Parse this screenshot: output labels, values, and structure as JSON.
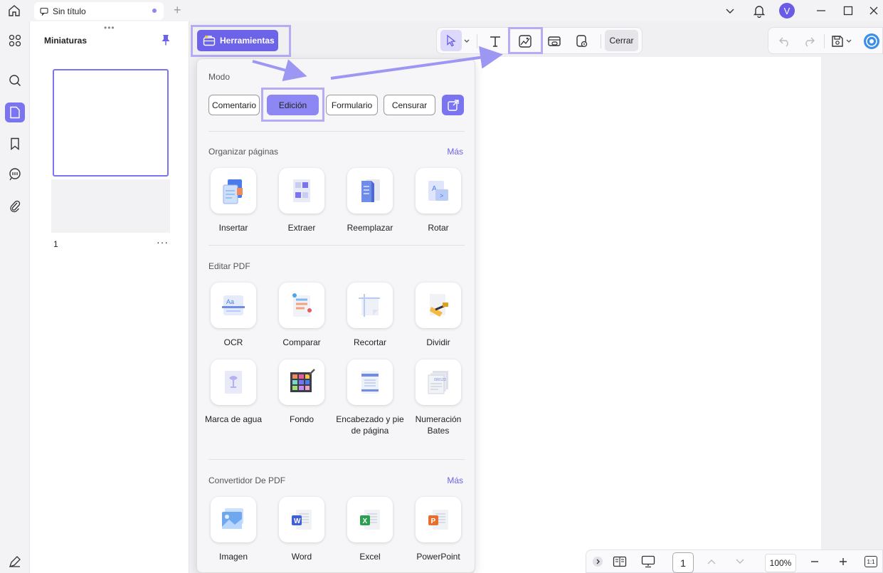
{
  "titlebar": {
    "tab_title": "Sin título",
    "new_tab": "+",
    "avatar_initial": "V"
  },
  "thumbnails": {
    "title": "Miniaturas",
    "grip": "•••",
    "page_number": "1",
    "more": "···"
  },
  "toolbar": {
    "tools_label": "Herramientas",
    "close_label": "Cerrar"
  },
  "panel": {
    "mode_title": "Modo",
    "modes": [
      {
        "label": "Comentario",
        "active": false
      },
      {
        "label": "Edición",
        "active": true
      },
      {
        "label": "Formulario",
        "active": false
      },
      {
        "label": "Censurar",
        "active": false
      }
    ],
    "organize": {
      "title": "Organizar páginas",
      "more": "Más",
      "items": [
        "Insertar",
        "Extraer",
        "Reemplazar",
        "Rotar"
      ]
    },
    "edit_pdf": {
      "title": "Editar PDF",
      "items": [
        "OCR",
        "Comparar",
        "Recortar",
        "Dividir",
        "Marca de agua",
        "Fondo",
        "Encabezado y pie de página",
        "Numeración Bates"
      ]
    },
    "converter": {
      "title": "Convertidor De PDF",
      "more": "Más",
      "items": [
        "Imagen",
        "Word",
        "Excel",
        "PowerPoint"
      ]
    }
  },
  "bottombar": {
    "page": "1",
    "zoom": "100%",
    "fit": "1:1"
  },
  "colors": {
    "accent": "#6c63e9",
    "highlight_frame": "#b4adf6",
    "active_mode": "#8d87f3"
  }
}
